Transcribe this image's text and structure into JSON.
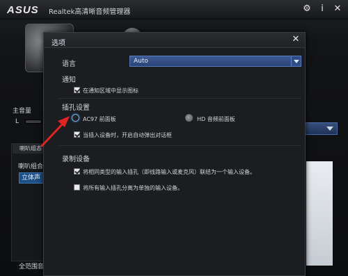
{
  "app": {
    "logo": "ASUS",
    "title": "Realtek高清晰音频管理器",
    "icons": {
      "settings": "gear-icon",
      "info": "info-icon",
      "close": "close-icon"
    }
  },
  "background": {
    "main_volume_label": "主音量",
    "channel_label": "L",
    "left_tab_label": "喇叭组态",
    "left_group_label": "喇叭组合",
    "stereo_label": "立体声",
    "fullrange_label": "全范围音"
  },
  "dialog": {
    "title": "选项",
    "language": {
      "label": "语言",
      "value": "Auto"
    },
    "notify": {
      "label": "通知",
      "checkbox_label": "在通知区域中显示图标",
      "checked": true
    },
    "jack": {
      "label": "插孔设置",
      "ac97_label": "AC97 前面板",
      "hd_label": "HD 音频前面板",
      "ac97_selected": true,
      "popup_label": "当插入设备时，开启自动弹出对话框",
      "popup_checked": true
    },
    "recording": {
      "label": "录制设备",
      "merge_label": "将相同类型的输入插孔（即线路输入或麦克风）联结为一个输入设备。",
      "merge_checked": true,
      "separate_label": "将所有输入插孔分离为单独的输入设备。",
      "separate_checked": false
    }
  },
  "colors": {
    "accent": "#2b4478",
    "annotation_arrow": "#e02424"
  }
}
